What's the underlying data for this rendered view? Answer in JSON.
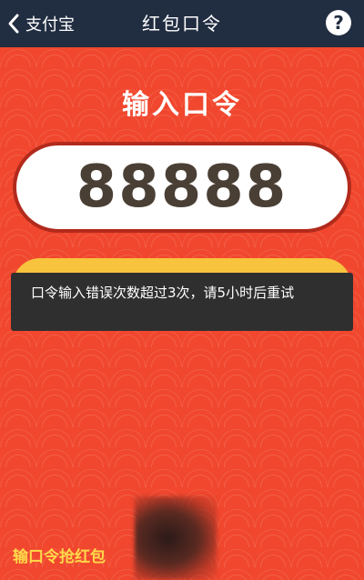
{
  "navbar": {
    "back_label": "支付宝",
    "title": "红包口令",
    "help_glyph": "?"
  },
  "main": {
    "heading": "输入口令",
    "code_value": "88888",
    "toast_message": "口令输入错误次数超过3次，请5小时后重试",
    "footer_link": "输口令抢红包"
  },
  "colors": {
    "navbar_bg": "#212d41",
    "page_bg": "#f0472e",
    "button_gold": "#f8c33d",
    "toast_bg": "#2f2f2f",
    "footer_text": "#ffd94a"
  },
  "icons": [
    "chevron-left-icon",
    "help-icon"
  ]
}
